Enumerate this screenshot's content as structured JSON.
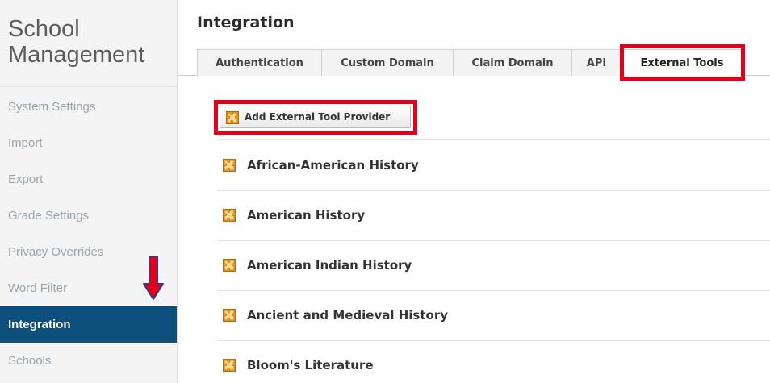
{
  "brand": {
    "line1": "School",
    "line2": "Management"
  },
  "sidebar": {
    "items": [
      {
        "label": "System Settings",
        "active": false
      },
      {
        "label": "Import",
        "active": false
      },
      {
        "label": "Export",
        "active": false
      },
      {
        "label": "Grade Settings",
        "active": false
      },
      {
        "label": "Privacy Overrides",
        "active": false
      },
      {
        "label": "Word Filter",
        "active": false
      },
      {
        "label": "Integration",
        "active": true
      },
      {
        "label": "Schools",
        "active": false
      }
    ]
  },
  "main": {
    "title": "Integration",
    "tabs": [
      {
        "label": "Authentication",
        "active": false
      },
      {
        "label": "Custom Domain",
        "active": false
      },
      {
        "label": "Claim Domain",
        "active": false
      },
      {
        "label": "API",
        "active": false
      },
      {
        "label": "External Tools",
        "active": true
      }
    ],
    "add_button_label": "Add External Tool Provider",
    "tools": [
      {
        "name": "African-American History"
      },
      {
        "name": "American History"
      },
      {
        "name": "American Indian History"
      },
      {
        "name": "Ancient and Medieval History"
      },
      {
        "name": "Bloom's Literature"
      }
    ]
  },
  "colors": {
    "active_nav": "#0c4f7c",
    "highlight": "#e3001b",
    "arrow_red": "#e3001b",
    "arrow_blue": "#2a3b8f"
  },
  "icons": {
    "tool": "puzzle-piece-icon",
    "annotation": "down-arrow-icon"
  }
}
